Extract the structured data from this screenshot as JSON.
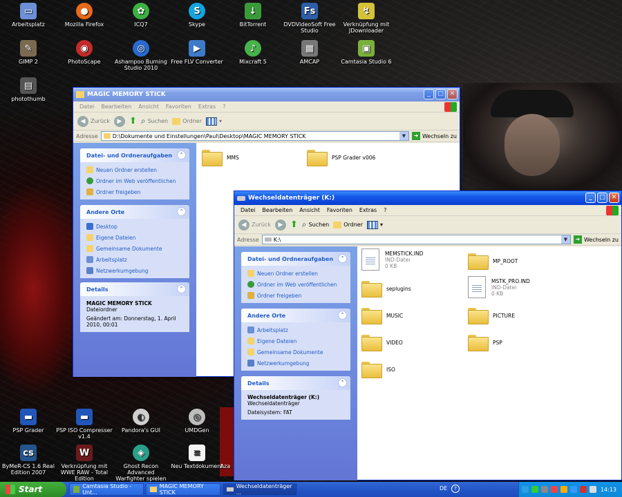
{
  "desktop": {
    "icons_top": [
      {
        "label": "Arbeitsplatz",
        "icon": "computer-icon"
      },
      {
        "label": "Mozilla Firefox",
        "icon": "firefox-icon"
      },
      {
        "label": "ICQ7",
        "icon": "icq-icon"
      },
      {
        "label": "Skype",
        "icon": "skype-icon"
      },
      {
        "label": "BitTorrent",
        "icon": "bittorrent-icon"
      },
      {
        "label": "DVDVideoSoft Free Studio",
        "icon": "dvdvideosoft-icon"
      },
      {
        "label": "Verknüpfung mit JDownloader",
        "icon": "jdownloader-icon"
      },
      {
        "label": "GIMP 2",
        "icon": "gimp-icon"
      },
      {
        "label": "PhotoScape",
        "icon": "photoscape-icon"
      },
      {
        "label": "Ashampoo Burning Studio 2010",
        "icon": "ashampoo-icon"
      },
      {
        "label": "Free FLV Converter",
        "icon": "flv-converter-icon"
      },
      {
        "label": "Mixcraft 5",
        "icon": "mixcraft-icon"
      },
      {
        "label": "AMCAP",
        "icon": "amcap-icon"
      },
      {
        "label": "Camtasia Studio 6",
        "icon": "camtasia-icon"
      },
      {
        "label": "photothumb",
        "icon": "photothumb-icon"
      }
    ],
    "icons_bottom": [
      {
        "label": "PSP Grader",
        "icon": "psp-grader-icon"
      },
      {
        "label": "PSP ISO Compresser v1.4",
        "icon": "psp-iso-icon"
      },
      {
        "label": "Pandora's GUI",
        "icon": "pandora-icon"
      },
      {
        "label": "UMDGen",
        "icon": "umdgen-icon"
      },
      {
        "label": "ByMeR-CS 1.6 Real Edition 2007",
        "icon": "cs-icon"
      },
      {
        "label": "Verknüpfung mit WWE RAW - Total Edition",
        "icon": "wwe-icon"
      },
      {
        "label": "Ghost Recon Advanced Warfighter spielen",
        "icon": "ghost-recon-icon"
      },
      {
        "label": "Neu Textdokument",
        "icon": "text-document-icon"
      },
      {
        "label": "Aza",
        "icon": "unknown-icon"
      }
    ]
  },
  "win1": {
    "title": "MAGIC MEMORY STICK",
    "menu": [
      "Datei",
      "Bearbeiten",
      "Ansicht",
      "Favoriten",
      "Extras",
      "?"
    ],
    "back": "Zurück",
    "search": "Suchen",
    "folders": "Ordner",
    "address_label": "Adresse",
    "address": "D:\\Dokumente und Einstellungen\\Paul\\Desktop\\MAGIC MEMORY STICK",
    "go": "Wechseln zu",
    "tasks_title": "Datei- und Ordneraufgaben",
    "tasks": [
      "Neuen Ordner erstellen",
      "Ordner im Web veröffentlichen",
      "Ordner freigeben"
    ],
    "places_title": "Andere Orte",
    "places": [
      "Desktop",
      "Eigene Dateien",
      "Gemeinsame Dokumente",
      "Arbeitsplatz",
      "Netzwerkumgebung"
    ],
    "details_title": "Details",
    "details_name": "MAGIC MEMORY STICK",
    "details_type": "Dateiordner",
    "details_changed": "Geändert am: Donnerstag, 1. April 2010, 00:01",
    "items": [
      "MMS",
      "PSP Grader v006"
    ]
  },
  "win2": {
    "title": "Wechseldatenträger (K:)",
    "menu": [
      "Datei",
      "Bearbeiten",
      "Ansicht",
      "Favoriten",
      "Extras",
      "?"
    ],
    "back": "Zurück",
    "search": "Suchen",
    "folders": "Ordner",
    "address_label": "Adresse",
    "address": "K:\\",
    "go": "Wechseln zu",
    "tasks_title": "Datei- und Ordneraufgaben",
    "tasks": [
      "Neuen Ordner erstellen",
      "Ordner im Web veröffentlichen",
      "Ordner freigeben"
    ],
    "places_title": "Andere Orte",
    "places": [
      "Arbeitsplatz",
      "Eigene Dateien",
      "Gemeinsame Dokumente",
      "Netzwerkumgebung"
    ],
    "details_title": "Details",
    "details_name": "Wechseldatenträger (K:)",
    "details_type": "Wechseldatenträger",
    "details_fs": "Dateisystem: FAT",
    "items": [
      {
        "name": "MEMSTICK.IND",
        "type": "IND-Datei",
        "size": "0 KB",
        "kind": "file"
      },
      {
        "name": "MP_ROOT",
        "kind": "folder"
      },
      {
        "name": "seplugins",
        "kind": "folder"
      },
      {
        "name": "MSTK_PRO.IND",
        "type": "IND-Datei",
        "size": "0 KB",
        "kind": "file"
      },
      {
        "name": "MUSIC",
        "kind": "folder"
      },
      {
        "name": "PICTURE",
        "kind": "folder"
      },
      {
        "name": "VIDEO",
        "kind": "folder"
      },
      {
        "name": "PSP",
        "kind": "folder"
      },
      {
        "name": "ISO",
        "kind": "folder"
      }
    ]
  },
  "taskbar": {
    "start": "Start",
    "tasks": [
      "Camtasia Studio - Unt...",
      "MAGIC MEMORY STICK",
      "Wechseldatenträger ..."
    ],
    "lang": "DE",
    "clock": "14:13"
  }
}
